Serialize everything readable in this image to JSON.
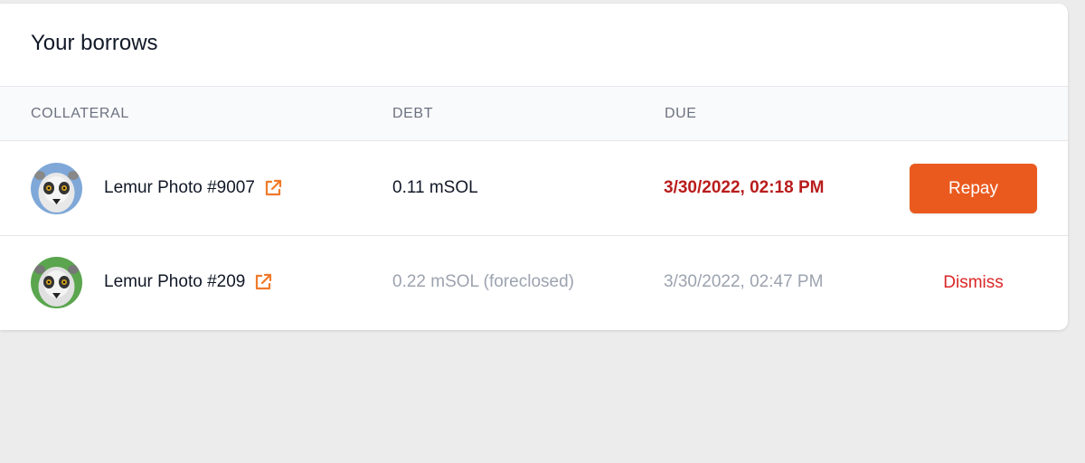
{
  "card": {
    "title": "Your borrows"
  },
  "table": {
    "headers": {
      "collateral": "COLLATERAL",
      "debt": "DEBT",
      "due": "DUE"
    },
    "rows": [
      {
        "name": "Lemur Photo #9007",
        "debt": "0.11 mSOL",
        "due": "3/30/2022, 02:18 PM",
        "action": "Repay",
        "avatar_bg": "#7fa8d8"
      },
      {
        "name": "Lemur Photo #209",
        "debt": "0.22 mSOL (foreclosed)",
        "due": "3/30/2022, 02:47 PM",
        "action": "Dismiss",
        "avatar_bg": "#5aa54e"
      }
    ]
  },
  "colors": {
    "accent": "#ea5a1f",
    "overdue": "#b91c1c",
    "dismiss": "#dc2626",
    "link_icon": "#f07a2a"
  },
  "icons": {
    "external_link": "external-link-icon"
  }
}
